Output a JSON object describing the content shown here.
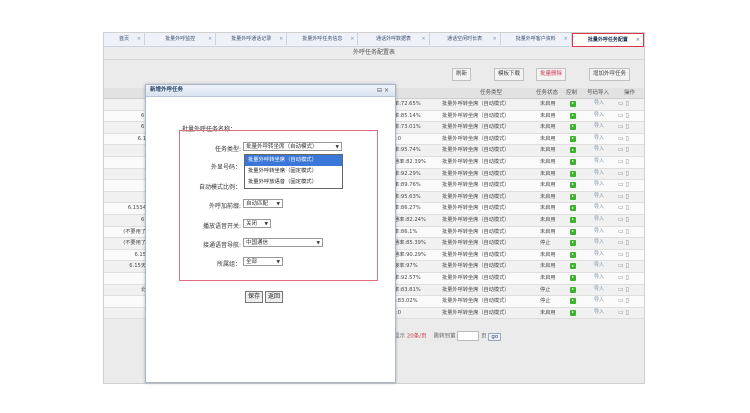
{
  "tabs": [
    {
      "label": "首页",
      "active": false
    },
    {
      "label": "批量外呼监控",
      "active": false
    },
    {
      "label": "批量外呼通话记录",
      "active": false
    },
    {
      "label": "批量外呼任务信息",
      "active": false
    },
    {
      "label": "通话外呼数据表",
      "active": false
    },
    {
      "label": "通话空闲时长表",
      "active": false
    },
    {
      "label": "批量外呼客户资料",
      "active": false
    },
    {
      "label": "批量外呼任务配置",
      "active": true
    }
  ],
  "close_glyph": "×",
  "page_subtitle": "外呼任务配置表",
  "toolbar": {
    "refresh": "刷新",
    "template_download": "模板下载",
    "batch_delete": "批量删除",
    "add_task": "增加外呼任务"
  },
  "table_headers": {
    "task_type": "任务类型",
    "task_status": "任务状态",
    "control": "控制",
    "number_import": "号码导入",
    "action": "操作"
  },
  "rows": [
    {
      "rate": "率:72.65%",
      "type": "批量外呼转坐席（自动模式）",
      "status": "未启用"
    },
    {
      "rate": "率:85.14%",
      "type": "批量外呼转坐席（自动模式）",
      "status": "未启用"
    },
    {
      "rate": "率:73.01%",
      "type": "批量外呼转坐席（自动模式）",
      "status": "未启用"
    },
    {
      "rate": "):0",
      "type": "批量外呼转坐席（自动模式）",
      "status": "未启用"
    },
    {
      "rate": "率:95.74%",
      "type": "批量外呼转坐席（自动模式）",
      "status": "未启用"
    },
    {
      "rate": "通率:82.39%",
      "type": "批量外呼转坐席（自动模式）",
      "status": "未启用"
    },
    {
      "rate": "率:92.29%",
      "type": "批量外呼转坐席（自动模式）",
      "status": "未启用"
    },
    {
      "rate": "率:89.76%",
      "type": "批量外呼转坐席（自动模式）",
      "status": "未启用"
    },
    {
      "rate": "率:95.63%",
      "type": "批量外呼转坐席（自动模式）",
      "status": "未启用"
    },
    {
      "rate": "率:86.27%",
      "type": "批量外呼转坐席（自动模式）",
      "status": "未启用"
    },
    {
      "rate": "通率:82.24%",
      "type": "批量外呼转坐席（自动模式）",
      "status": "未启用"
    },
    {
      "rate": "率:86.1%",
      "type": "批量外呼转坐席（自动模式）",
      "status": "未启用"
    },
    {
      "rate": "通率:85.39%",
      "type": "批量外呼转坐席（自动模式）",
      "status": "停止"
    },
    {
      "rate": "通率:90.29%",
      "type": "批量外呼转坐席（自动模式）",
      "status": "未启用"
    },
    {
      "rate": "接率:97%",
      "type": "批量外呼转坐席（自动模式）",
      "status": "未启用"
    },
    {
      "rate": "率:92.57%",
      "type": "批量外呼转坐席（自动模式）",
      "status": "未启用"
    },
    {
      "rate": "率:83.81%",
      "type": "批量外呼转坐席（自动模式）",
      "status": "停止"
    },
    {
      "rate": "):83.02%",
      "type": "批量外呼转坐席（自动模式）",
      "status": "停止"
    },
    {
      "rate": "):0",
      "type": "批量外呼转坐席（自动模式）",
      "status": "未启用"
    }
  ],
  "import_label": "导入",
  "left_fragments": [
    "6.",
    "6.",
    "6.1",
    "6.1534",
    "6.",
    "(不要用了",
    "(不要用了",
    "6.15",
    "6.15天",
    "北"
  ],
  "pager": {
    "prefix": "显示",
    "per_page": "20条/页",
    "jump_label": "跳转到第",
    "page_suffix": "页",
    "go": "go"
  },
  "modal": {
    "title": "新增外呼任务",
    "name_label": "批量外呼任务名称：",
    "task_type_label": "任务类型:",
    "task_type_value": "批量外呼转坐席（自动模式）",
    "options": [
      "批量外呼转坐席（自动模式）",
      "批量外呼转坐席（固定模式）",
      "批量外呼放语音（固定模式）"
    ],
    "selected_option_index": 0,
    "ext_number_label": "外显号码：",
    "auto_ratio_label": "自动模式比例：",
    "prefix_label": "外呼加前缀:",
    "prefix_value": "自动匹配",
    "voice_switch_label": "播放语音开关:",
    "voice_switch_value": "关闭",
    "nav_label": "接通语音导航:",
    "nav_value": "中国通信",
    "region_label": "所属组：",
    "region_value": "全部",
    "save": "保存",
    "back": "返回"
  }
}
